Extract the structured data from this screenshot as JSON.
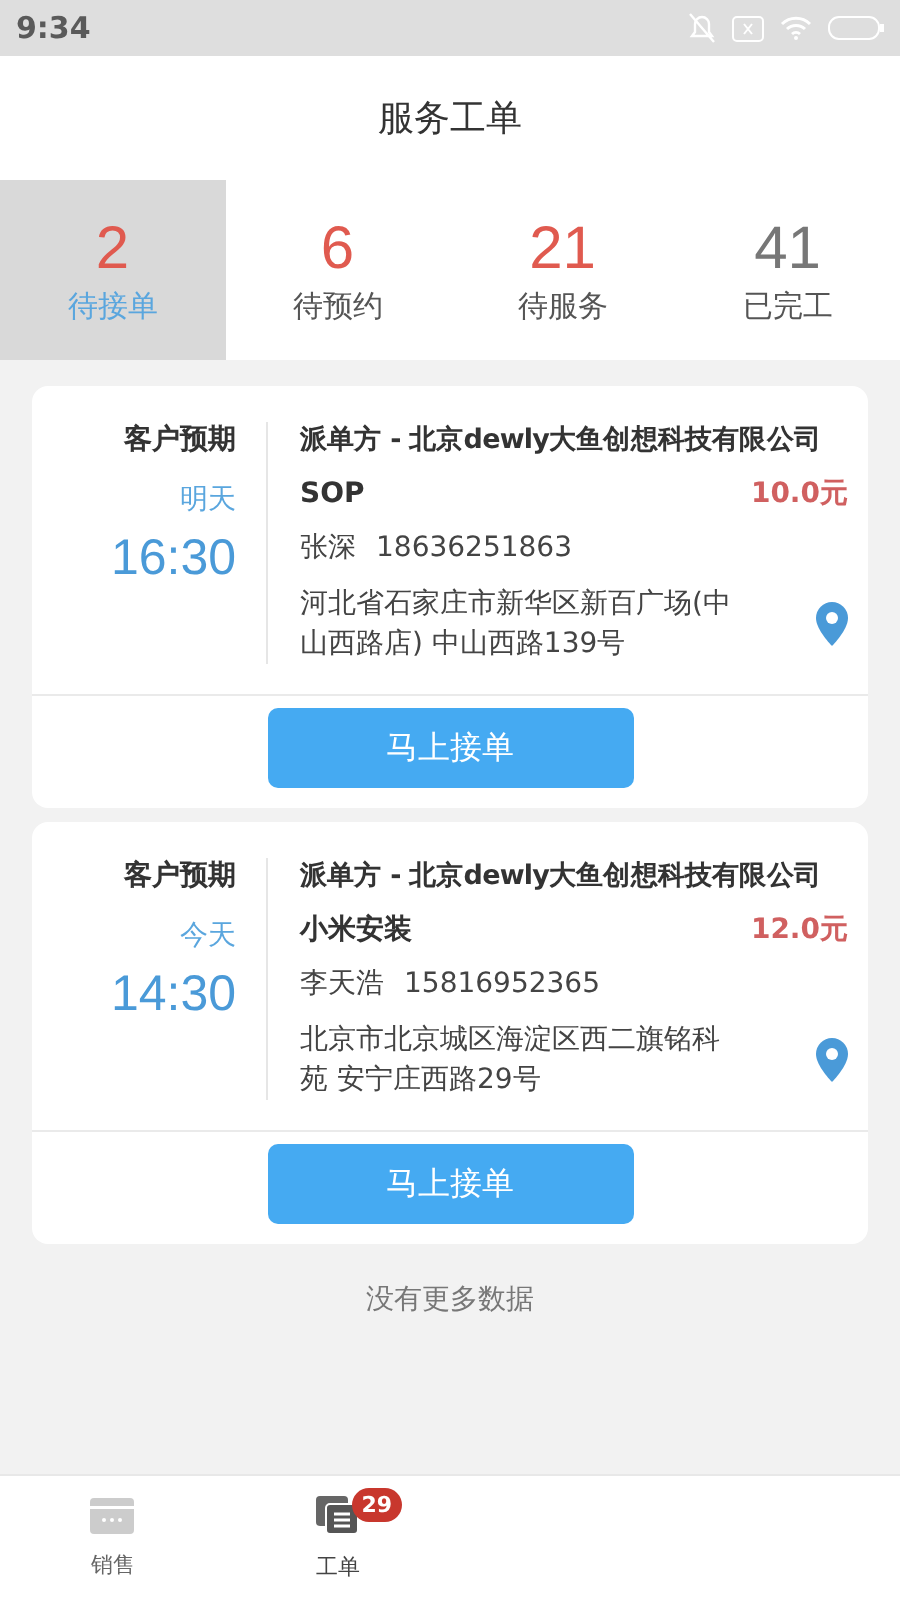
{
  "status_bar": {
    "time": "9:34"
  },
  "header": {
    "title": "服务工单"
  },
  "tabs": [
    {
      "count": "2",
      "label": "待接单",
      "selected": true,
      "highlight": true
    },
    {
      "count": "6",
      "label": "待预约",
      "selected": false,
      "highlight": true
    },
    {
      "count": "21",
      "label": "待服务",
      "selected": false,
      "highlight": true
    },
    {
      "count": "41",
      "label": "已完工",
      "selected": false,
      "highlight": false
    }
  ],
  "orders": [
    {
      "expect_label": "客户预期",
      "day": "明天",
      "time": "16:30",
      "dispatcher": "派单方 - 北京dewly大鱼创想科技有限公司",
      "service": "SOP",
      "price": "10.0元",
      "contact": "张深",
      "phone": "18636251863",
      "address": "河北省石家庄市新华区新百广场(中山西路店) 中山西路139号",
      "button": "马上接单"
    },
    {
      "expect_label": "客户预期",
      "day": "今天",
      "time": "14:30",
      "dispatcher": "派单方 - 北京dewly大鱼创想科技有限公司",
      "service": "小米安装",
      "price": "12.0元",
      "contact": "李天浩",
      "phone": "15816952365",
      "address": "北京市北京城区海淀区西二旗铭科苑 安宁庄西路29号",
      "button": "马上接单"
    }
  ],
  "footer_note": "没有更多数据",
  "bottom_nav": [
    {
      "label": "销售",
      "selected": false
    },
    {
      "label": "工单",
      "selected": true,
      "badge": "29"
    }
  ]
}
